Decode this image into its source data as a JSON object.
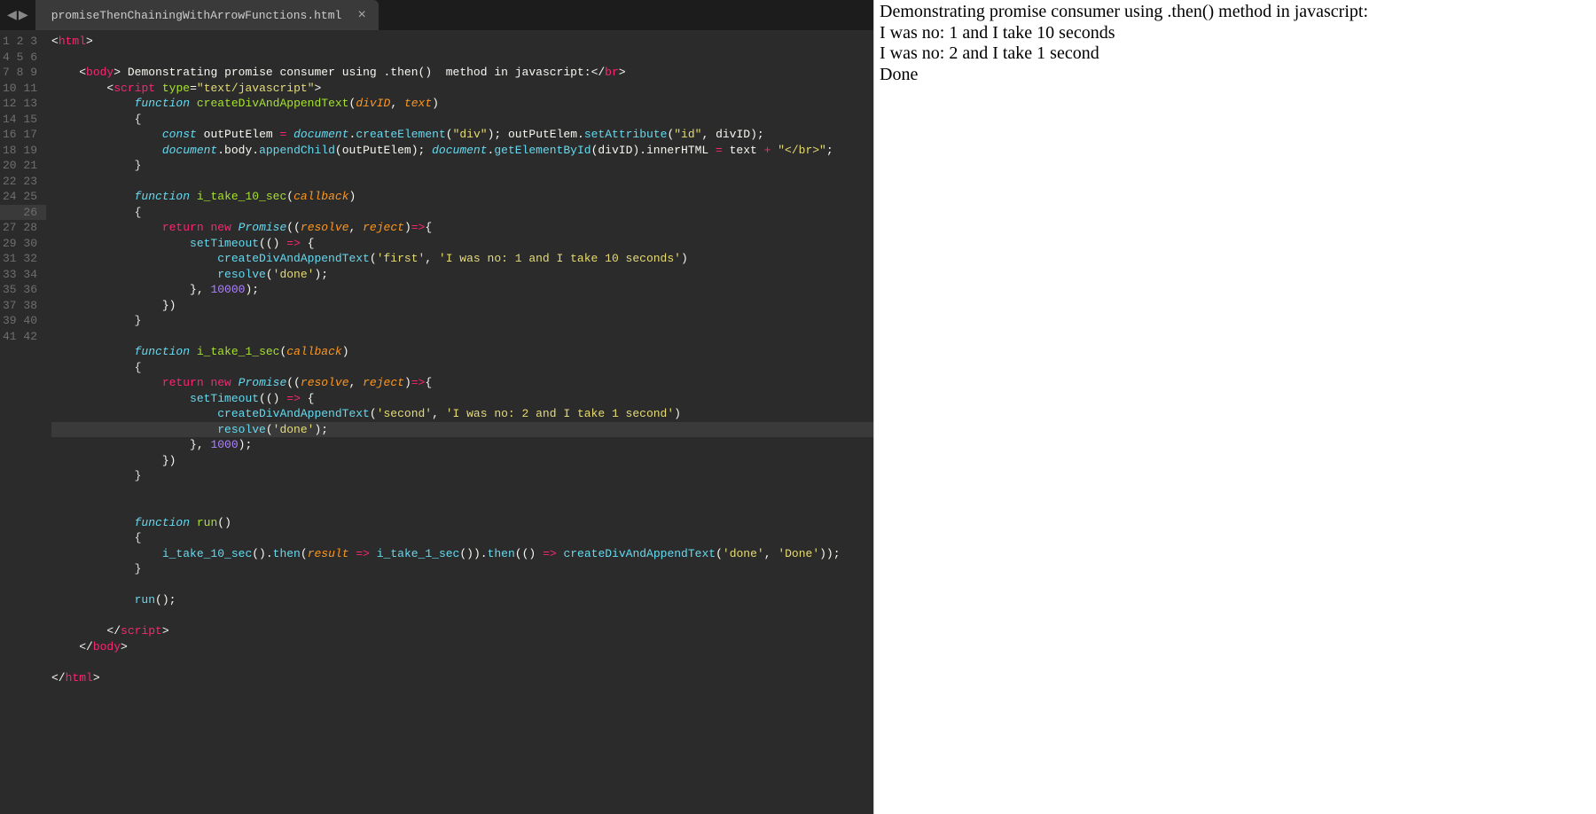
{
  "tab": {
    "title": "promiseThenChainingWithArrowFunctions.html",
    "close": "×"
  },
  "nav": {
    "left": "◀",
    "right": "▶"
  },
  "gutter": {
    "start": 1,
    "end": 42,
    "highlight": 26
  },
  "output": {
    "lines": [
      "Demonstrating promise consumer using .then() method in javascript:",
      "I was no: 1 and I take 10 seconds",
      "I was no: 2 and I take 1 second",
      "Done"
    ]
  },
  "code": {
    "lines": [
      [
        [
          "<",
          "punc"
        ],
        [
          "html",
          "tagn"
        ],
        [
          ">",
          "punc"
        ]
      ],
      [],
      [
        [
          "    ",
          null
        ],
        [
          "<",
          "punc"
        ],
        [
          "body",
          "tagn"
        ],
        [
          ">",
          "punc"
        ],
        [
          " Demonstrating promise consumer using .then()  method in javascript:",
          "nm"
        ],
        [
          "</",
          "punc"
        ],
        [
          "br",
          "tagn"
        ],
        [
          ">",
          "punc"
        ]
      ],
      [
        [
          "        ",
          null
        ],
        [
          "<",
          "punc"
        ],
        [
          "script",
          "tagn"
        ],
        [
          " ",
          null
        ],
        [
          "type",
          "attr"
        ],
        [
          "=",
          "punc"
        ],
        [
          "\"text/javascript\"",
          "str"
        ],
        [
          ">",
          "punc"
        ]
      ],
      [
        [
          "            ",
          null
        ],
        [
          "function",
          "stor"
        ],
        [
          " ",
          null
        ],
        [
          "createDivAndAppendText",
          "func"
        ],
        [
          "(",
          "punc"
        ],
        [
          "divID",
          "param"
        ],
        [
          ",",
          "punc"
        ],
        [
          " ",
          null
        ],
        [
          "text",
          "param"
        ],
        [
          ")",
          "punc"
        ]
      ],
      [
        [
          "            {",
          null
        ]
      ],
      [
        [
          "                ",
          null
        ],
        [
          "const",
          "stor"
        ],
        [
          " ",
          null
        ],
        [
          "outPutElem ",
          "nm"
        ],
        [
          "=",
          "op"
        ],
        [
          " ",
          null
        ],
        [
          "document",
          "builtin"
        ],
        [
          ".",
          "punc"
        ],
        [
          "createElement",
          "call"
        ],
        [
          "(",
          "punc"
        ],
        [
          "\"div\"",
          "str"
        ],
        [
          "); outPutElem.",
          "nm"
        ],
        [
          "setAttribute",
          "call"
        ],
        [
          "(",
          "punc"
        ],
        [
          "\"id\"",
          "str"
        ],
        [
          ", divID);",
          "nm"
        ]
      ],
      [
        [
          "                ",
          null
        ],
        [
          "document",
          "builtin"
        ],
        [
          ".body.",
          "nm"
        ],
        [
          "appendChild",
          "call"
        ],
        [
          "(outPutElem); ",
          "nm"
        ],
        [
          "document",
          "builtin"
        ],
        [
          ".",
          "punc"
        ],
        [
          "getElementById",
          "call"
        ],
        [
          "(divID).innerHTML ",
          "nm"
        ],
        [
          "=",
          "op"
        ],
        [
          " text ",
          "nm"
        ],
        [
          "+",
          "op"
        ],
        [
          " ",
          null
        ],
        [
          "\"</br>\"",
          "str"
        ],
        [
          ";",
          "nm"
        ]
      ],
      [
        [
          "            }",
          null
        ]
      ],
      [],
      [
        [
          "            ",
          null
        ],
        [
          "function",
          "stor"
        ],
        [
          " ",
          null
        ],
        [
          "i_take_10_sec",
          "func"
        ],
        [
          "(",
          "punc"
        ],
        [
          "callback",
          "param"
        ],
        [
          ")",
          "punc"
        ]
      ],
      [
        [
          "            {",
          null
        ]
      ],
      [
        [
          "                ",
          null
        ],
        [
          "return",
          "kw"
        ],
        [
          " ",
          null
        ],
        [
          "new",
          "kw"
        ],
        [
          " ",
          null
        ],
        [
          "Promise",
          "builtin"
        ],
        [
          "((",
          "punc"
        ],
        [
          "resolve",
          "param"
        ],
        [
          ",",
          "punc"
        ],
        [
          " ",
          null
        ],
        [
          "reject",
          "param"
        ],
        [
          ")",
          "punc"
        ],
        [
          "=>",
          "op"
        ],
        [
          "{",
          "punc"
        ]
      ],
      [
        [
          "                    ",
          null
        ],
        [
          "setTimeout",
          "call"
        ],
        [
          "(() ",
          "nm"
        ],
        [
          "=>",
          "op"
        ],
        [
          " {",
          "nm"
        ]
      ],
      [
        [
          "                        ",
          null
        ],
        [
          "createDivAndAppendText",
          "call"
        ],
        [
          "(",
          "punc"
        ],
        [
          "'first'",
          "str"
        ],
        [
          ", ",
          "nm"
        ],
        [
          "'I was no: 1 and I take 10 seconds'",
          "str"
        ],
        [
          ")",
          "punc"
        ]
      ],
      [
        [
          "                        ",
          null
        ],
        [
          "resolve",
          "call"
        ],
        [
          "(",
          "punc"
        ],
        [
          "'done'",
          "str"
        ],
        [
          ");",
          "nm"
        ]
      ],
      [
        [
          "                    }, ",
          "nm"
        ],
        [
          "10000",
          "num"
        ],
        [
          ");",
          "nm"
        ]
      ],
      [
        [
          "                })",
          "nm"
        ]
      ],
      [
        [
          "            }",
          null
        ]
      ],
      [],
      [
        [
          "            ",
          null
        ],
        [
          "function",
          "stor"
        ],
        [
          " ",
          null
        ],
        [
          "i_take_1_sec",
          "func"
        ],
        [
          "(",
          "punc"
        ],
        [
          "callback",
          "param"
        ],
        [
          ")",
          "punc"
        ]
      ],
      [
        [
          "            {",
          null
        ]
      ],
      [
        [
          "                ",
          null
        ],
        [
          "return",
          "kw"
        ],
        [
          " ",
          null
        ],
        [
          "new",
          "kw"
        ],
        [
          " ",
          null
        ],
        [
          "Promise",
          "builtin"
        ],
        [
          "((",
          "punc"
        ],
        [
          "resolve",
          "param"
        ],
        [
          ",",
          "punc"
        ],
        [
          " ",
          null
        ],
        [
          "reject",
          "param"
        ],
        [
          ")",
          "punc"
        ],
        [
          "=>",
          "op"
        ],
        [
          "{",
          "punc"
        ]
      ],
      [
        [
          "                    ",
          null
        ],
        [
          "setTimeout",
          "call"
        ],
        [
          "(() ",
          "nm"
        ],
        [
          "=>",
          "op"
        ],
        [
          " {",
          "nm"
        ]
      ],
      [
        [
          "                        ",
          null
        ],
        [
          "createDivAndAppendText",
          "call"
        ],
        [
          "(",
          "punc"
        ],
        [
          "'second'",
          "str"
        ],
        [
          ", ",
          "nm"
        ],
        [
          "'I was no: 2 and I take 1 second'",
          "str"
        ],
        [
          ")",
          "punc"
        ]
      ],
      [
        [
          "                        ",
          null
        ],
        [
          "resolve",
          "call"
        ],
        [
          "(",
          "punc"
        ],
        [
          "'done'",
          "str"
        ],
        [
          ");",
          "nm"
        ]
      ],
      [
        [
          "                    }, ",
          "nm"
        ],
        [
          "1000",
          "num"
        ],
        [
          ");",
          "nm"
        ]
      ],
      [
        [
          "                })",
          "nm"
        ]
      ],
      [
        [
          "            }",
          null
        ]
      ],
      [],
      [],
      [
        [
          "            ",
          null
        ],
        [
          "function",
          "stor"
        ],
        [
          " ",
          null
        ],
        [
          "run",
          "func"
        ],
        [
          "()",
          "punc"
        ]
      ],
      [
        [
          "            {",
          null
        ]
      ],
      [
        [
          "                ",
          null
        ],
        [
          "i_take_10_sec",
          "call"
        ],
        [
          "().",
          "nm"
        ],
        [
          "then",
          "call"
        ],
        [
          "(",
          "punc"
        ],
        [
          "result",
          "param"
        ],
        [
          " ",
          null
        ],
        [
          "=>",
          "op"
        ],
        [
          " ",
          null
        ],
        [
          "i_take_1_sec",
          "call"
        ],
        [
          "()).",
          "nm"
        ],
        [
          "then",
          "call"
        ],
        [
          "(() ",
          "nm"
        ],
        [
          "=>",
          "op"
        ],
        [
          " ",
          null
        ],
        [
          "createDivAndAppendText",
          "call"
        ],
        [
          "(",
          "punc"
        ],
        [
          "'done'",
          "str"
        ],
        [
          ", ",
          "nm"
        ],
        [
          "'Done'",
          "str"
        ],
        [
          "));",
          "nm"
        ]
      ],
      [
        [
          "            }",
          null
        ]
      ],
      [],
      [
        [
          "            ",
          null
        ],
        [
          "run",
          "call"
        ],
        [
          "();",
          "nm"
        ]
      ],
      [],
      [
        [
          "        ",
          null
        ],
        [
          "</",
          "punc"
        ],
        [
          "script",
          "tagn"
        ],
        [
          ">",
          "punc"
        ]
      ],
      [
        [
          "    ",
          null
        ],
        [
          "</",
          "punc"
        ],
        [
          "body",
          "tagn"
        ],
        [
          ">",
          "punc"
        ]
      ],
      [],
      [
        [
          "</",
          "punc"
        ],
        [
          "html",
          "tagn"
        ],
        [
          ">",
          "punc"
        ]
      ]
    ]
  }
}
